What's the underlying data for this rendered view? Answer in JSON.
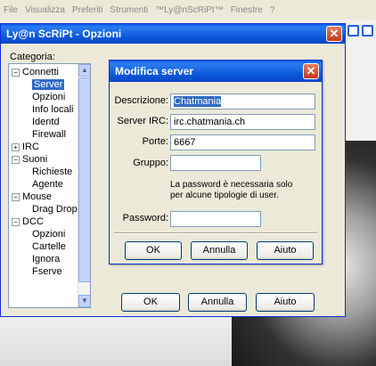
{
  "app": {
    "menu": [
      "File",
      "Visualizza",
      "Preferiti",
      "Strumenti",
      "™Ly@nScRiPt™",
      "Finestre",
      "?"
    ]
  },
  "options_window": {
    "title": "Ly@n ScRiPt - Opzioni",
    "category_label": "Categoria:",
    "tree": [
      {
        "label": "Connetti",
        "toggle": "−",
        "level": 0
      },
      {
        "label": "Server",
        "level": 1,
        "selected": true
      },
      {
        "label": "Opzioni",
        "level": 1
      },
      {
        "label": "Info locali",
        "level": 1
      },
      {
        "label": "Identd",
        "level": 1
      },
      {
        "label": "Firewall",
        "level": 1
      },
      {
        "label": "IRC",
        "toggle": "+",
        "level": 0
      },
      {
        "label": "Suoni",
        "toggle": "−",
        "level": 0
      },
      {
        "label": "Richieste",
        "level": 1
      },
      {
        "label": "Agente",
        "level": 1
      },
      {
        "label": "Mouse",
        "toggle": "−",
        "level": 0
      },
      {
        "label": "Drag Drop",
        "level": 1
      },
      {
        "label": "DCC",
        "toggle": "−",
        "level": 0
      },
      {
        "label": "Opzioni",
        "level": 1
      },
      {
        "label": "Cartelle",
        "level": 1
      },
      {
        "label": "Ignora",
        "level": 1
      },
      {
        "label": "Fserve",
        "level": 1
      }
    ],
    "buttons": {
      "ok": "OK",
      "cancel": "Annulla",
      "help": "Aiuto"
    }
  },
  "modal": {
    "title": "Modifica server",
    "fields": {
      "description": {
        "label": "Descrizione:",
        "value": "Chatmania"
      },
      "irc_server": {
        "label": "Server IRC:",
        "value": "irc.chatmania.ch"
      },
      "ports": {
        "label": "Porte:",
        "value": "6667"
      },
      "group": {
        "label": "Gruppo:",
        "value": ""
      },
      "password": {
        "label": "Password:",
        "value": ""
      }
    },
    "note": "La password è necessaria solo per alcune tipologie di user.",
    "buttons": {
      "ok": "OK",
      "cancel": "Annulla",
      "help": "Aiuto"
    }
  },
  "colors": {
    "titlebar": "#0a55d7",
    "selection": "#316ac5",
    "close": "#c5361a"
  }
}
